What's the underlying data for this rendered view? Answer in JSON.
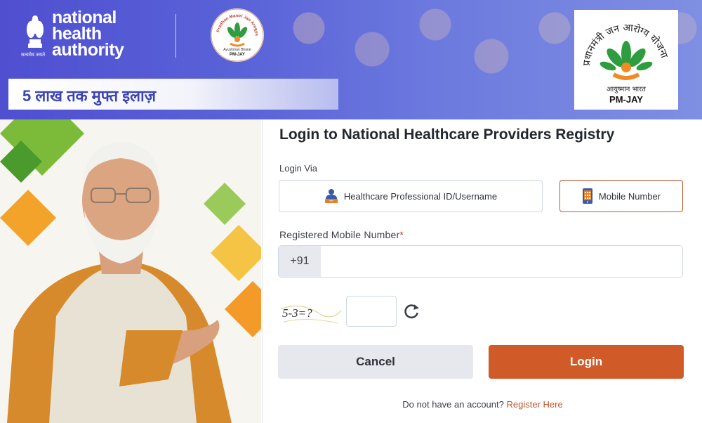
{
  "header": {
    "org_name_line1": "national",
    "org_name_line2": "health",
    "org_name_line3": "authority",
    "emblem_motto": "सत्यमेव जयते",
    "tagline": "5 लाख तक मुफ्त इलाज़",
    "pmjay_logo_text": "प्रधानमंत्री जन आरोग्य योजना",
    "pmjay_logo_sub": "आयुष्मान भारत",
    "pmjay_logo_code": "PM-JAY",
    "pmjay_small_text": "Pradhan Mantri Jan Arogya Yojana",
    "pmjay_small_sub": "Ayushman Bharat",
    "pmjay_small_code": "PM-JAY"
  },
  "login": {
    "title": "Login to National Healthcare Providers Registry",
    "via_label": "Login Via",
    "options": [
      {
        "label": "Healthcare Professional ID/Username",
        "icon": "user-id-icon",
        "selected": false
      },
      {
        "label": "Mobile Number",
        "icon": "mobile-phone-icon",
        "selected": true
      }
    ],
    "mobile_label": "Registered Mobile Number",
    "required_mark": "*",
    "country_code": "+91",
    "mobile_value": "",
    "captcha_text": "5-3=?",
    "captcha_value": "",
    "cancel_label": "Cancel",
    "login_label": "Login",
    "signup_prompt": "Do not have an account?",
    "signup_link": "Register Here"
  },
  "colors": {
    "accent": "#d05a28",
    "header_blue": "#4f4fd0",
    "tagline_blue": "#3c44b0",
    "cancel_bg": "#e6e8ee"
  }
}
